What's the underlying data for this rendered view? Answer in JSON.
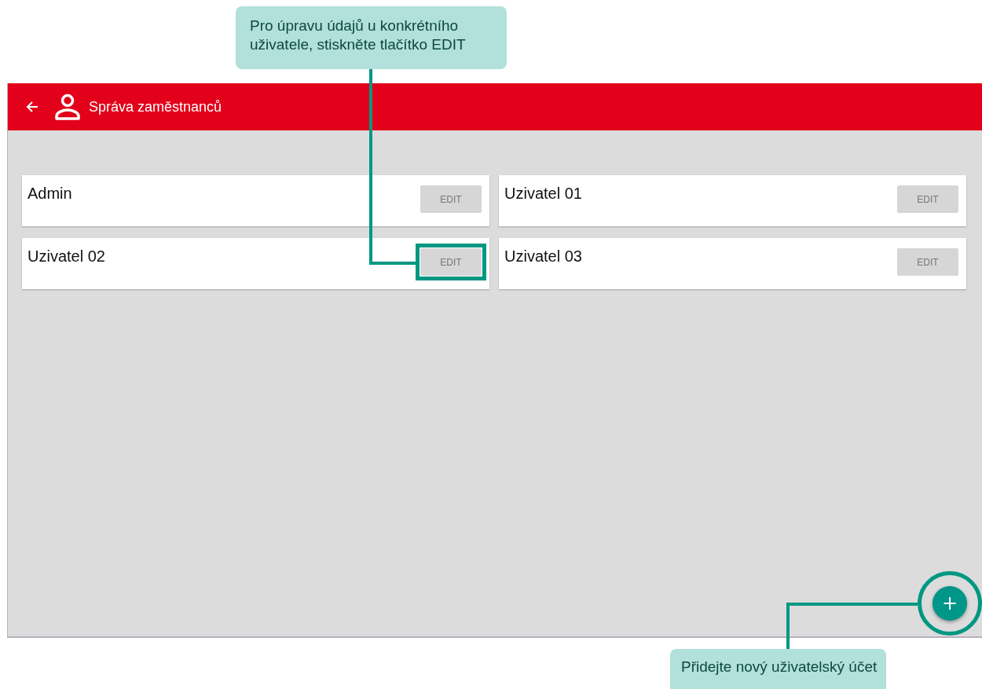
{
  "app_bar": {
    "title": "Správa zaměstnanců"
  },
  "users": [
    {
      "name": "Admin",
      "edit_label": "EDIT",
      "disabled": true,
      "highlighted": false
    },
    {
      "name": "Uzivatel 01",
      "edit_label": "EDIT",
      "disabled": true,
      "highlighted": false
    },
    {
      "name": "Uzivatel 02",
      "edit_label": "EDIT",
      "disabled": true,
      "highlighted": true
    },
    {
      "name": "Uzivatel 03",
      "edit_label": "EDIT",
      "disabled": true,
      "highlighted": false
    }
  ],
  "fab": {
    "label": "+",
    "highlighted": true
  },
  "callouts": [
    {
      "text": "Pro úpravu údajů u konkrétního uživatele, stiskněte tlačítko EDIT",
      "kind": "top"
    },
    {
      "text": "Přidejte nový uživatelský účet",
      "kind": "bottom"
    }
  ]
}
